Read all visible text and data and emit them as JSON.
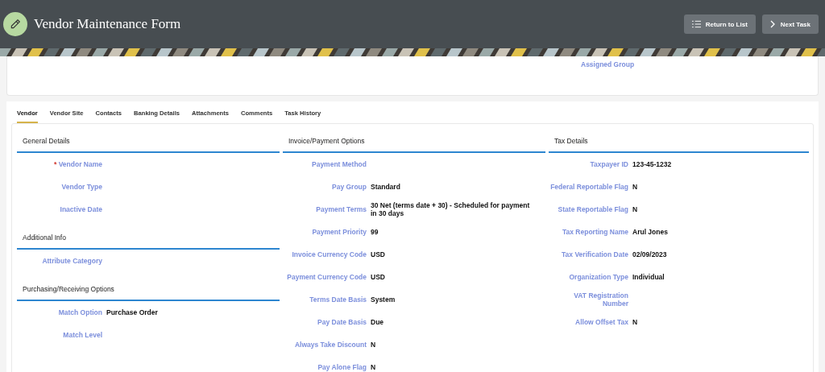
{
  "header": {
    "title": "Vendor Maintenance Form",
    "buttons": [
      {
        "label": "Return to List",
        "kind": "list"
      },
      {
        "label": "Next Task",
        "kind": "next"
      }
    ]
  },
  "required_symbol": "*",
  "summary": {
    "fields": [
      {
        "label": "Assigned Group"
      }
    ]
  },
  "tabs": [
    {
      "label": "Vendor",
      "selected": true
    },
    {
      "label": "Vendor Site",
      "selected": false
    },
    {
      "label": "Contacts",
      "selected": false
    },
    {
      "label": "Banking Details",
      "selected": false
    },
    {
      "label": "Attachments",
      "selected": false
    },
    {
      "label": "Comments",
      "selected": false
    },
    {
      "label": "Task History",
      "selected": false
    }
  ],
  "columns": [
    {
      "sections": [
        {
          "title": "General Details",
          "fields": [
            {
              "label": "Vendor Name",
              "required": true
            },
            {
              "label": "Vendor Type",
              "required": false
            },
            {
              "label": "Inactive Date",
              "required": false
            }
          ]
        },
        {
          "title": "Additional Info",
          "fields": [
            {
              "label": "Attribute Category",
              "required": false
            }
          ]
        },
        {
          "title": "Purchasing/Receiving Options",
          "fields": [
            {
              "label": "Match Option",
              "value": "Purchase Order",
              "required": false
            },
            {
              "label": "Match Level",
              "required": false
            }
          ]
        }
      ]
    },
    {
      "sections": [
        {
          "title": "Invoice/Payment Options",
          "fields": [
            {
              "label": "Payment Method",
              "required": false
            },
            {
              "label": "Pay Group",
              "value": "Standard",
              "required": false
            },
            {
              "label": "Payment Terms",
              "value": "30 Net (terms date + 30) - Scheduled for payment in 30 days",
              "required": false
            },
            {
              "label": "Payment Priority",
              "value": "99",
              "required": false
            },
            {
              "label": "Invoice Currency Code",
              "value": "USD",
              "required": false
            },
            {
              "label": "Payment Currency Code",
              "value": "USD",
              "required": false
            },
            {
              "label": "Terms Date Basis",
              "value": "System",
              "required": false
            },
            {
              "label": "Pay Date Basis",
              "value": "Due",
              "required": false
            },
            {
              "label": "Always Take Discount",
              "value": "N",
              "required": false
            },
            {
              "label": "Pay Alone Flag",
              "value": "N",
              "required": false
            }
          ]
        }
      ]
    },
    {
      "sections": [
        {
          "title": "Tax Details",
          "fields": [
            {
              "label": "Taxpayer ID",
              "value": "123-45-1232",
              "required": false
            },
            {
              "label": "Federal Reportable Flag",
              "value": "N",
              "required": false
            },
            {
              "label": "State Reportable Flag",
              "value": "N",
              "required": false
            },
            {
              "label": "Tax Reporting Name",
              "value": "Arul Jones",
              "required": false
            },
            {
              "label": "Tax Verification Date",
              "value": "02/09/2023",
              "required": false
            },
            {
              "label": "Organization Type",
              "value": "Individual",
              "required": false
            },
            {
              "label": "VAT Registration Number",
              "required": false
            },
            {
              "label": "Allow Offset Tax",
              "value": "N",
              "required": false
            }
          ]
        }
      ]
    }
  ]
}
